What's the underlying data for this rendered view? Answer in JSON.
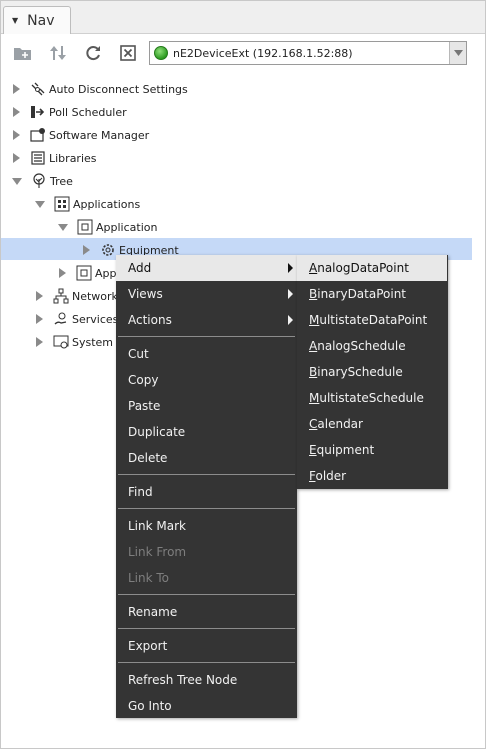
{
  "panel": {
    "title": "Nav"
  },
  "toolbar": {
    "buttons": [
      "new-folder-icon",
      "sort-arrows-icon",
      "refresh-icon",
      "close-box-icon"
    ],
    "device_selector": {
      "value": "nE2DeviceExt (192.168.1.52:88)",
      "status_color": "#2e9b22"
    }
  },
  "tree": {
    "items": [
      {
        "label": "Auto Disconnect Settings",
        "icon": "disconnect-icon"
      },
      {
        "label": "Poll Scheduler",
        "icon": "poll-scheduler-icon"
      },
      {
        "label": "Software Manager",
        "icon": "software-manager-icon"
      },
      {
        "label": "Libraries",
        "icon": "libraries-icon"
      },
      {
        "label": "Tree",
        "icon": "tree-icon"
      },
      {
        "label": "Applications",
        "icon": "applications-icon"
      },
      {
        "label": "Application",
        "icon": "application-icon"
      },
      {
        "label": "Equipment",
        "icon": "gear-icon"
      },
      {
        "label": "App",
        "icon": "application-icon"
      },
      {
        "label": "Network",
        "icon": "network-icon"
      },
      {
        "label": "Services",
        "icon": "services-icon"
      },
      {
        "label": "System",
        "icon": "system-icon"
      }
    ]
  },
  "context_menu": {
    "items": [
      {
        "label": "Add",
        "submenu": true
      },
      {
        "label": "Views",
        "submenu": true
      },
      {
        "label": "Actions",
        "submenu": true
      },
      {
        "label": "Cut"
      },
      {
        "label": "Copy"
      },
      {
        "label": "Paste"
      },
      {
        "label": "Duplicate"
      },
      {
        "label": "Delete"
      },
      {
        "label": "Find"
      },
      {
        "label": "Link Mark"
      },
      {
        "label": "Link From",
        "disabled": true
      },
      {
        "label": "Link To",
        "disabled": true
      },
      {
        "label": "Rename"
      },
      {
        "label": "Export"
      },
      {
        "label": "Refresh Tree Node"
      },
      {
        "label": "Go Into"
      }
    ]
  },
  "add_submenu": {
    "items": [
      {
        "label": "AnalogDataPoint"
      },
      {
        "label": "BinaryDataPoint"
      },
      {
        "label": "MultistateDataPoint"
      },
      {
        "label": "AnalogSchedule"
      },
      {
        "label": "BinarySchedule"
      },
      {
        "label": "MultistateSchedule"
      },
      {
        "label": "Calendar"
      },
      {
        "label": "Equipment"
      },
      {
        "label": "Folder"
      }
    ]
  },
  "colors": {
    "menu_bg": "#343434",
    "highlight": "#e8e8e8",
    "selection": "#c5d9f7"
  }
}
